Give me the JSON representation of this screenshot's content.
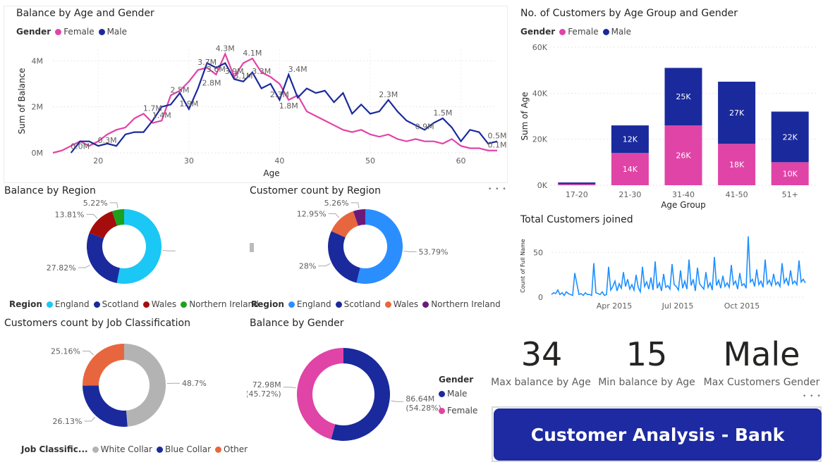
{
  "colors": {
    "female": "#e044a7",
    "male": "#1a2a9c",
    "england": "#1ac7f5",
    "scotland": "#1a2a9c",
    "wales": "#a50d0d",
    "ni": "#1ba11e",
    "cr_england": "#2b8eff",
    "cr_wales": "#e8663d",
    "cr_ni": "#6a1b7a",
    "white_collar": "#b3b3b3",
    "blue_collar": "#1a2a9c",
    "other_job": "#e8663d"
  },
  "balance_age": {
    "title": "Balance by Age and Gender",
    "legend_title": "Gender",
    "chart_data": {
      "type": "line",
      "xlabel": "Age",
      "ylabel": "Sum of Balance",
      "xlim": [
        15,
        64
      ],
      "ylim": [
        0,
        4500000
      ],
      "x_ticks": [
        "20",
        "30",
        "40",
        "50",
        "60"
      ],
      "y_ticks": [
        "0M",
        "2M",
        "4M"
      ],
      "series": [
        {
          "name": "Female",
          "color": "#e044a7",
          "x": [
            15,
            16,
            17,
            18,
            19,
            20,
            21,
            22,
            23,
            24,
            25,
            26,
            27,
            28,
            29,
            30,
            31,
            32,
            33,
            34,
            35,
            36,
            37,
            38,
            39,
            40,
            41,
            42,
            43,
            44,
            45,
            46,
            47,
            48,
            49,
            50,
            51,
            52,
            53,
            54,
            55,
            56,
            57,
            58,
            59,
            60,
            61,
            62,
            63,
            64
          ],
          "y": [
            0,
            0.1,
            0.3,
            0.5,
            0.3,
            0.5,
            0.8,
            1.0,
            1.1,
            1.5,
            1.7,
            1.3,
            1.4,
            2.5,
            2.7,
            3.1,
            3.6,
            3.7,
            3.4,
            4.3,
            3.3,
            3.9,
            4.1,
            3.5,
            3.3,
            3.0,
            2.3,
            2.5,
            1.8,
            1.6,
            1.4,
            1.2,
            1.0,
            0.9,
            1.0,
            0.8,
            0.7,
            0.8,
            0.6,
            0.5,
            0.6,
            0.5,
            0.5,
            0.4,
            0.6,
            0.3,
            0.2,
            0.2,
            0.1,
            0.1
          ]
        },
        {
          "name": "Male",
          "color": "#1a2a9c",
          "x": [
            17,
            18,
            19,
            20,
            21,
            22,
            23,
            24,
            25,
            26,
            27,
            28,
            29,
            30,
            31,
            32,
            33,
            34,
            35,
            36,
            37,
            38,
            39,
            40,
            41,
            42,
            43,
            44,
            45,
            46,
            47,
            48,
            49,
            50,
            51,
            52,
            53,
            54,
            55,
            56,
            57,
            58,
            59,
            60,
            61,
            62,
            63,
            64
          ],
          "y": [
            0,
            0.5,
            0.5,
            0.3,
            0.4,
            0.3,
            0.8,
            0.9,
            0.9,
            1.4,
            2.0,
            2.1,
            2.6,
            1.9,
            2.8,
            3.9,
            3.7,
            3.9,
            3.2,
            3.1,
            3.5,
            2.8,
            3.0,
            2.3,
            3.4,
            2.4,
            2.8,
            2.6,
            2.7,
            2.2,
            2.6,
            1.7,
            2.1,
            1.7,
            1.8,
            2.3,
            1.8,
            1.4,
            1.2,
            1.0,
            1.3,
            1.5,
            1.1,
            0.5,
            1.0,
            0.9,
            0.4,
            0.5
          ]
        }
      ],
      "annotations": [
        {
          "x": 18,
          "y": 0.05,
          "label": "0.0M"
        },
        {
          "x": 21,
          "y": 0.3,
          "label": "0.3M"
        },
        {
          "x": 26,
          "y": 1.7,
          "label": "1.7M"
        },
        {
          "x": 27,
          "y": 1.4,
          "label": "1.4M"
        },
        {
          "x": 29,
          "y": 2.5,
          "label": "2.5M"
        },
        {
          "x": 30,
          "y": 1.9,
          "label": "1.9M"
        },
        {
          "x": 32,
          "y": 3.7,
          "label": "3.7M"
        },
        {
          "x": 32.5,
          "y": 2.8,
          "label": "2.8M"
        },
        {
          "x": 33,
          "y": 3.4,
          "label": "3.6M"
        },
        {
          "x": 34,
          "y": 4.3,
          "label": "4.3M"
        },
        {
          "x": 35,
          "y": 3.3,
          "label": "3.9M"
        },
        {
          "x": 36,
          "y": 3.1,
          "label": "3.1M"
        },
        {
          "x": 37,
          "y": 4.1,
          "label": "4.1M"
        },
        {
          "x": 38,
          "y": 3.3,
          "label": "3.3M"
        },
        {
          "x": 40,
          "y": 2.3,
          "label": "2.3M"
        },
        {
          "x": 41,
          "y": 1.8,
          "label": "1.8M"
        },
        {
          "x": 42,
          "y": 3.4,
          "label": "3.4M"
        },
        {
          "x": 52,
          "y": 2.3,
          "label": "2.3M"
        },
        {
          "x": 56,
          "y": 0.9,
          "label": "0.9M"
        },
        {
          "x": 58,
          "y": 1.5,
          "label": "1.5M"
        },
        {
          "x": 64,
          "y": 0.5,
          "label": "0.5M"
        },
        {
          "x": 64,
          "y": 0.1,
          "label": "0.1M"
        }
      ]
    }
  },
  "customers_age": {
    "title": "No. of Customers by Age Group and Gender",
    "legend_title": "Gender",
    "chart_data": {
      "type": "bar",
      "stacked": true,
      "xlabel": "Age Group",
      "ylabel": "Sum of Age",
      "categories": [
        "17-20",
        "21-30",
        "31-40",
        "41-50",
        "51+"
      ],
      "ylim": [
        0,
        60000
      ],
      "y_ticks": [
        "0K",
        "20K",
        "40K",
        "60K"
      ],
      "series": [
        {
          "name": "Female",
          "color": "#e044a7",
          "values": [
            500,
            14000,
            26000,
            18000,
            10000
          ],
          "labels": [
            "",
            "14K",
            "26K",
            "18K",
            "10K"
          ]
        },
        {
          "name": "Male",
          "color": "#1a2a9c",
          "values": [
            700,
            12000,
            25000,
            27000,
            22000
          ],
          "labels": [
            "",
            "12K",
            "25K",
            "27K",
            "22K"
          ]
        }
      ]
    }
  },
  "balance_region": {
    "title": "Balance by Region",
    "legend_title": "Region",
    "chart_data": {
      "type": "pie",
      "donut": true,
      "slices": [
        {
          "name": "England",
          "value": 53.15,
          "color": "#1ac7f5"
        },
        {
          "name": "Scotland",
          "value": 27.82,
          "color": "#1a2a9c",
          "label": "27.82%"
        },
        {
          "name": "Wales",
          "value": 13.81,
          "color": "#a50d0d",
          "label": "13.81%"
        },
        {
          "name": "Northern Ireland",
          "value": 5.22,
          "color": "#1ba11e",
          "label": "5.22%"
        }
      ]
    }
  },
  "customer_region": {
    "title": "Customer count by Region",
    "legend_title": "Region",
    "chart_data": {
      "type": "pie",
      "donut": true,
      "slices": [
        {
          "name": "England",
          "value": 53.79,
          "color": "#2b8eff",
          "label": "53.79%"
        },
        {
          "name": "Scotland",
          "value": 28,
          "color": "#1a2a9c",
          "label": "28%"
        },
        {
          "name": "Wales",
          "value": 12.95,
          "color": "#e8663d",
          "label": "12.95%"
        },
        {
          "name": "Northern Ireland",
          "value": 5.26,
          "color": "#6a1b7a",
          "label": "5.26%"
        }
      ]
    }
  },
  "total_customers": {
    "title": "Total Customers joined",
    "chart_data": {
      "type": "line",
      "ylabel": "Count of Full Name",
      "ylim": [
        0,
        70
      ],
      "y_ticks": [
        "0",
        "50"
      ],
      "x_ticks": [
        "Apr 2015",
        "Jul 2015",
        "Oct 2015"
      ],
      "x_start": "2015-01-01",
      "x_end": "2015-12-31",
      "values": [
        3,
        5,
        4,
        8,
        3,
        5,
        2,
        6,
        4,
        3,
        2,
        27,
        15,
        3,
        4,
        2,
        5,
        3,
        3,
        2,
        38,
        5,
        4,
        3,
        6,
        2,
        3,
        34,
        8,
        12,
        18,
        7,
        15,
        10,
        28,
        12,
        20,
        9,
        14,
        8,
        25,
        11,
        6,
        34,
        12,
        17,
        9,
        22,
        8,
        40,
        10,
        16,
        7,
        26,
        11,
        13,
        9,
        37,
        14,
        12,
        8,
        30,
        10,
        18,
        9,
        42,
        13,
        20,
        7,
        33,
        15,
        12,
        9,
        28,
        11,
        16,
        8,
        45,
        13,
        19,
        10,
        24,
        12,
        16,
        11,
        36,
        14,
        18,
        9,
        27,
        13,
        15,
        10,
        68,
        17,
        20,
        12,
        31,
        14,
        18,
        11,
        42,
        15,
        19,
        13,
        26,
        14,
        17,
        12,
        38,
        16,
        21,
        13,
        30,
        15,
        18,
        14,
        41,
        17,
        20,
        16
      ]
    }
  },
  "job_class": {
    "title": "Customers count by Job Classification",
    "legend_title": "Job Classific...",
    "chart_data": {
      "type": "pie",
      "donut": true,
      "slices": [
        {
          "name": "White Collar",
          "value": 48.7,
          "color": "#b3b3b3",
          "label": "48.7%"
        },
        {
          "name": "Blue Collar",
          "value": 26.13,
          "color": "#1a2a9c",
          "label": "26.13%"
        },
        {
          "name": "Other",
          "value": 25.16,
          "color": "#e8663d",
          "label": "25.16%"
        }
      ]
    }
  },
  "balance_gender": {
    "title": "Balance by Gender",
    "legend_title": "Gender",
    "chart_data": {
      "type": "pie",
      "donut": true,
      "slices": [
        {
          "name": "Male",
          "value": 54.28,
          "color": "#1a2a9c",
          "label": "86.64M",
          "label2": "(54.28%)"
        },
        {
          "name": "Female",
          "value": 45.72,
          "color": "#e044a7",
          "label": "72.98M",
          "label2": "(45.72%)"
        }
      ]
    }
  },
  "kpis": [
    {
      "value": "34",
      "label": "Max balance by Age"
    },
    {
      "value": "15",
      "label": "Min balance by Age"
    },
    {
      "value": "Male",
      "label": "Max Customers Gender"
    }
  ],
  "banner": {
    "text": "Customer Analysis - Bank"
  },
  "more_glyph": "• • •"
}
